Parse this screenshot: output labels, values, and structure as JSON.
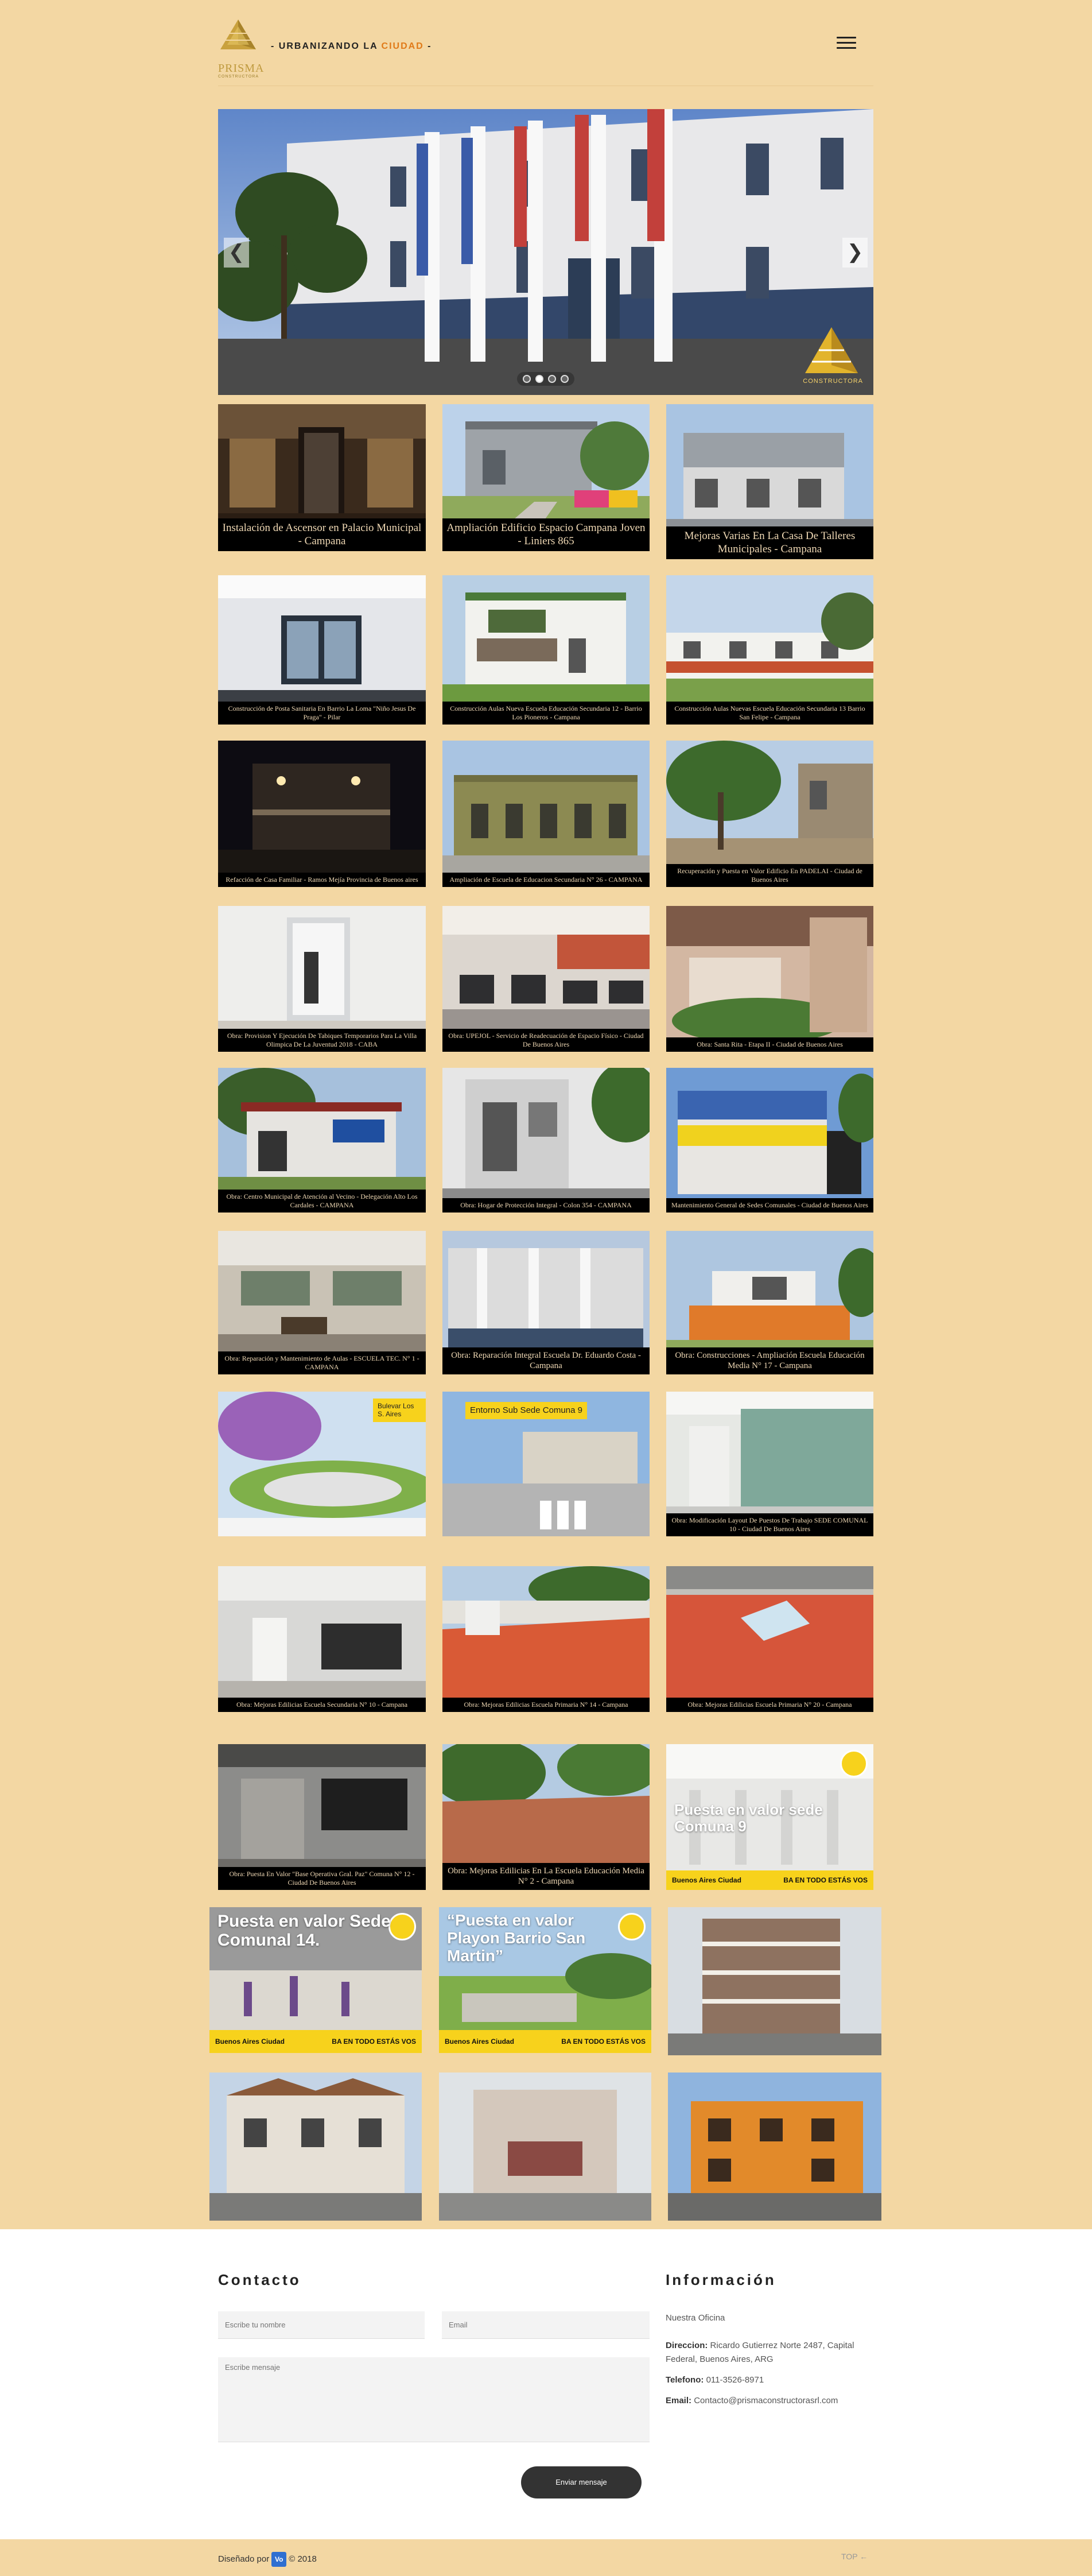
{
  "header": {
    "logo_text": "PRISMA",
    "logo_sub": "CONSTRUCTORA",
    "tagline_dash_left": "- ",
    "tagline_main": "URBANIZANDO LA ",
    "tagline_highlight": "CIUDAD",
    "tagline_dash_right": " -",
    "menu_icon": "hamburger-icon"
  },
  "hero": {
    "prev_label": "❮",
    "next_label": "❯",
    "slides_count": 4,
    "active_slide": 2,
    "brand_text": "CONSTRUCTORA"
  },
  "projects": [
    {
      "caption": "Instalación de Ascensor en Palacio Municipal - Campana"
    },
    {
      "caption": "Ampliación Edificio Espacio Campana Joven - Liniers 865"
    },
    {
      "caption": "Mejoras Varias En La Casa De Talleres Municipales - Campana"
    },
    {
      "caption": "Construcción de Posta Sanitaria En Barrio La Loma \"Niño Jesus De Praga\" - Pilar"
    },
    {
      "caption": "Construcción Aulas Nueva Escuela Educación Secundaria 12 - Barrio Los Pioneros - Campana"
    },
    {
      "caption": "Construcción Aulas Nuevas Escuela Educación Secundaria 13 Barrio San Felipe - Campana"
    },
    {
      "caption": "Refacción de Casa Familiar - Ramos Mejía Provincia de Buenos aires"
    },
    {
      "caption": "Ampliación de Escuela de Educacion Secundaria N° 26 - CAMPANA"
    },
    {
      "caption": "Recuperación y Puesta en Valor Edificio En PADELAI - Ciudad de Buenos Aires"
    },
    {
      "caption": "Obra: Provision Y Ejecución De Tabiques Temporarios Para La Villa Olimpica De La Juventud 2018 - CABA"
    },
    {
      "caption": "Obra: UPEJOL - Servicio de Readecuación de Espacio Físico - Ciudad De Buenos Aires"
    },
    {
      "caption": "Obra: Santa Rita - Etapa II - Ciudad de Buenos Aires"
    },
    {
      "caption": "Obra: Centro Municipal de Atención al Vecino - Delegación Alto Los Cardales - CAMPANA"
    },
    {
      "caption": "Obra: Hogar de Protección Integral - Colon 354 - CAMPANA"
    },
    {
      "caption": "Mantenimiento General de Sedes Comunales - Ciudad de Buenos Aires"
    },
    {
      "caption": "Obra: Reparación y Mantenimiento de Aulas - ESCUELA TEC. N° 1 - CAMPANA"
    },
    {
      "caption": "Obra: Reparación Integral Escuela Dr. Eduardo Costa - Campana"
    },
    {
      "caption": "Obra: Construcciones - Ampliación Escuela Educación Media N° 17 - Campana"
    },
    {
      "caption": ""
    },
    {
      "caption": ""
    },
    {
      "caption": "Obra: Modificación Layout De Puestos De Trabajo SEDE COMUNAL 10 - Ciudad De Buenos Aires"
    },
    {
      "caption": "Obra: Mejoras Edilicias Escuela Secundaria N° 10 - Campana"
    },
    {
      "caption": "Obra: Mejoras Edilicias Escuela Primaria N° 14 - Campana"
    },
    {
      "caption": "Obra: Mejoras Edilicias Escuela Primaria N° 20 - Campana"
    },
    {
      "caption": "Obra: Puesta En Valor \"Base Operativa Gral. Paz\" Comuna N° 12 - Ciudad De Buenos Aires"
    },
    {
      "caption": "Obra: Mejoras Edilicias En La Escuela Educación Media N° 2 - Campana"
    },
    {
      "caption": ""
    }
  ],
  "promos": {
    "sede9": "Puesta en valor sede Comuna 9",
    "sede14": "Puesta en valor Sede Comunal 14.",
    "playon": "“Puesta en valor Playon Barrio San Martin”",
    "ba_left": "Buenos Aires Ciudad",
    "ba_right": "BA EN TODO ESTÁS VOS",
    "bulevar_sign": "Bulevar Los S. Aires",
    "entorno_sign": "Entorno Sub Sede Comuna 9"
  },
  "contact": {
    "title": "Contacto",
    "name_placeholder": "Escribe tu nombre",
    "email_placeholder": "Email",
    "message_placeholder": "Escribe mensaje",
    "send_label": "Enviar mensaje"
  },
  "info": {
    "title": "Información",
    "office": "Nuestra Oficina",
    "address_label": "Direccion:",
    "address_value": "Ricardo Gutierrez Norte 2487, Capital Federal, Buenos Aires, ARG",
    "phone_label": "Telefono:",
    "phone_value": "011-3526-8971",
    "email_label": "Email:",
    "email_value": "Contacto@prismaconstructorasrl.com"
  },
  "footer": {
    "designed_by": "Diseñado por",
    "vo_badge": "Vo",
    "year": "© 2018",
    "top_link": "TOP ←"
  },
  "colors": {
    "background": "#f3d7a3",
    "accent_orange": "#e07a18",
    "caption_bg": "#000000",
    "footer_white": "#ffffff",
    "button_dark": "#333333",
    "ba_yellow": "#f7d21c"
  }
}
